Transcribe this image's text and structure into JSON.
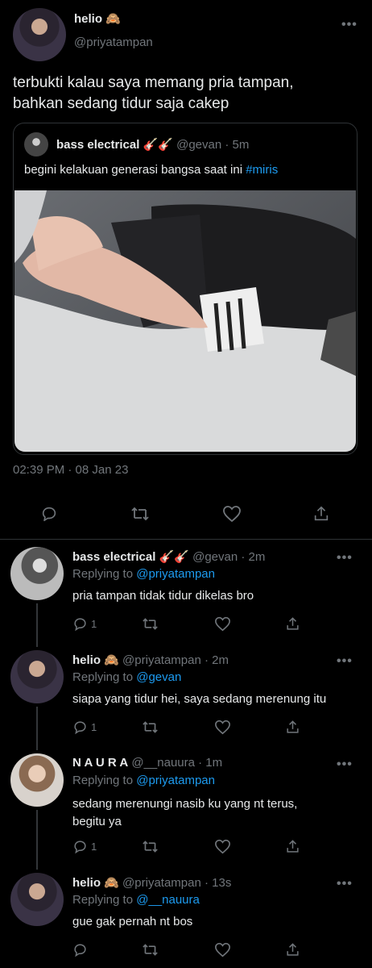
{
  "main_tweet": {
    "name": "helio",
    "emoji": "🙈",
    "handle": "@priyatampan",
    "more": "•••",
    "text_line1": "terbukti kalau saya memang pria tampan,",
    "text_line2": "bahkan sedang tidur saja cakep",
    "timestamp": "02:39 PM · 08 Jan 23",
    "quote": {
      "name": "bass electrical",
      "emoji": "🎸🎸",
      "handle_time": "@gevan · 5m",
      "text": "begini kelakuan generasi bangsa saat ini",
      "hashtag": "#miris"
    }
  },
  "replies": [
    {
      "name": "bass electrical",
      "emoji": "🎸🎸",
      "handle_time": "@gevan · 2m",
      "replying_prefix": "Replying to",
      "replying_to": "@priyatampan",
      "text_line1": "pria tampan tidak tidur dikelas bro",
      "text_line2": "",
      "reply_count": "1",
      "more": "•••"
    },
    {
      "name": "helio",
      "emoji": "🙈",
      "handle_time": "@priyatampan · 2m",
      "replying_prefix": "Replying to",
      "replying_to": "@gevan",
      "text_line1": "siapa yang tidur hei, saya sedang merenung itu",
      "text_line2": "",
      "reply_count": "1",
      "more": "•••"
    },
    {
      "name": "N A U R A",
      "emoji": "",
      "handle_time": "@__nauura · 1m",
      "replying_prefix": "Replying to",
      "replying_to": "@priyatampan",
      "text_line1": "sedang merenungi nasib ku yang nt terus,",
      "text_line2": "begitu ya",
      "reply_count": "1",
      "more": "•••"
    },
    {
      "name": "helio",
      "emoji": "🙈",
      "handle_time": "@priyatampan · 13s",
      "replying_prefix": "Replying to",
      "replying_to": "@__nauura",
      "text_line1": "gue gak pernah nt bos",
      "text_line2": "",
      "reply_count": "",
      "more": "•••"
    }
  ],
  "colors": {
    "background": "#000000",
    "text": "#e7e9ea",
    "muted": "#71767b",
    "link": "#1d9bf0",
    "divider": "#2f3336"
  }
}
